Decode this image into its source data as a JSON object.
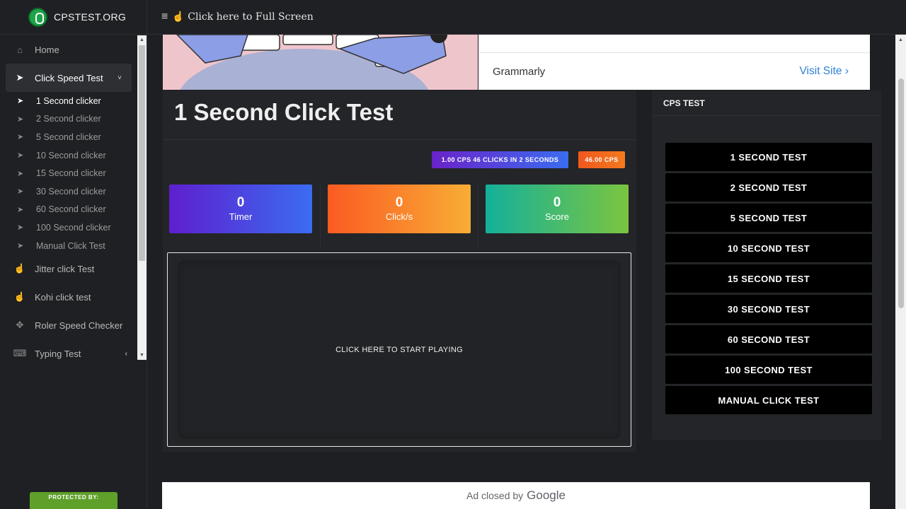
{
  "brand": {
    "name": "CPSTEST.ORG"
  },
  "topbar": {
    "menu_icon": "≡",
    "fullscreen_label": "☝ Click here to Full Screen"
  },
  "sidebar": {
    "items": [
      {
        "label": "Home",
        "icon": "home-icon"
      },
      {
        "label": "Click Speed Test",
        "icon": "cursor-icon",
        "expanded": true
      },
      {
        "label": "Jitter click Test",
        "icon": "hand-pointer-icon"
      },
      {
        "label": "Kohi click test",
        "icon": "hand-pointer-icon"
      },
      {
        "label": "Roler Speed Checker",
        "icon": "crosshair-icon"
      },
      {
        "label": "Typing Test",
        "icon": "keyboard-icon"
      }
    ],
    "sub_items": [
      "1 Second clicker",
      "2 Second clicker",
      "5 Second clicker",
      "10 Second clicker",
      "15 Second clicker",
      "30 Second clicker",
      "60 Second clicker",
      "100 Second clicker",
      "Manual Click Test"
    ],
    "current_sub": "1 Second clicker"
  },
  "dmca": {
    "label": "PROTECTED BY:"
  },
  "banner_ad": {
    "advertiser": "Grammarly",
    "cta": "Visit Site ›"
  },
  "main": {
    "title": "1 Second Click Test",
    "badge_cps": "1.00 CPS 46 CLICKS IN 2 SECONDS",
    "badge_count": "46.00 CPS",
    "stats": {
      "timer": {
        "value": "0",
        "label": "Timer"
      },
      "clicks": {
        "value": "0",
        "label": "Click/s"
      },
      "score": {
        "value": "0",
        "label": "Score"
      }
    },
    "play_prompt": "CLICK HERE TO START PLAYING"
  },
  "right_panel": {
    "heading": "CPS TEST",
    "buttons": [
      "1 SECOND TEST",
      "2 SECOND TEST",
      "5 SECOND TEST",
      "10 SECOND TEST",
      "15 SECOND TEST",
      "30 SECOND TEST",
      "60 SECOND TEST",
      "100 SECOND TEST",
      "MANUAL CLICK TEST"
    ]
  },
  "bottom_ad": {
    "label": "Ad closed by",
    "brand": "Google"
  },
  "colors": {
    "accent_purple": "#5e1fce",
    "accent_orange": "#fb5b22",
    "accent_green": "#14b09a",
    "link_blue": "#2f7fd6"
  }
}
